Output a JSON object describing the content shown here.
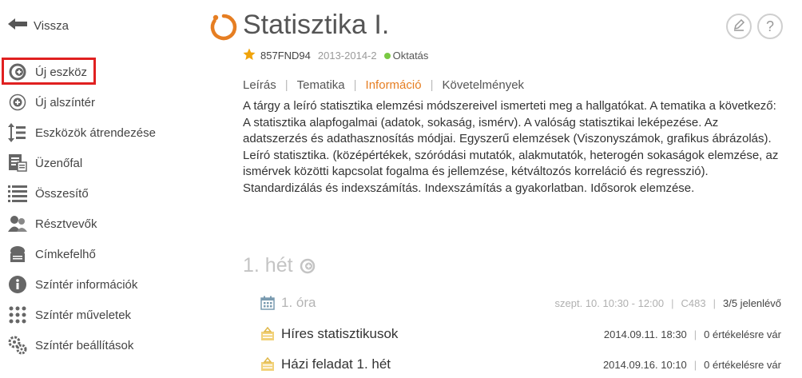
{
  "sidebar": {
    "back_label": "Vissza",
    "items": [
      {
        "label": "Új eszköz",
        "icon": "add-circle-icon"
      },
      {
        "label": "Új alszíntér",
        "icon": "add-circle-outline-icon"
      },
      {
        "label": "Eszközök átrendezése",
        "icon": "reorder-icon"
      },
      {
        "label": "Üzenőfal",
        "icon": "message-board-icon"
      },
      {
        "label": "Összesítő",
        "icon": "summary-list-icon"
      },
      {
        "label": "Résztvevők",
        "icon": "participants-icon"
      },
      {
        "label": "Címkefelhő",
        "icon": "tag-cloud-icon"
      },
      {
        "label": "Színtér információk",
        "icon": "info-icon"
      },
      {
        "label": "Színtér műveletek",
        "icon": "operations-icon"
      },
      {
        "label": "Színtér beállítások",
        "icon": "settings-icon"
      }
    ]
  },
  "header": {
    "title": "Statisztika I.",
    "code": "857FND94",
    "term": "2013-2014-2",
    "status": "Oktatás",
    "status_color": "#7ac943",
    "accent_color": "#e67e22"
  },
  "tabs": [
    {
      "label": "Leírás",
      "active": false
    },
    {
      "label": "Tematika",
      "active": false
    },
    {
      "label": "Információ",
      "active": true
    },
    {
      "label": "Követelmények",
      "active": false
    }
  ],
  "description": "A tárgy a leíró statisztika elemzési módszereivel ismerteti meg a hallgatókat.  A tematika a következő: A statisztika alapfogalmai (adatok, sokaság, ismérv). A valóság statisztikai leképezése. Az adatszerzés és adathasznosítás módjai. Egyszerű elemzések (Viszonyszámok, grafikus ábrázolás). Leíró statisztika. (középértékek, szóródási mutatók, alakmutatók, heterogén sokaságok elemzése, az ismérvek közötti kapcsolat fogalma és jellemzése, kétváltozós korreláció és regresszió). Standardizálás és indexszámítás. Indexszámítás a gyakorlatban. Idősorok elemzése.",
  "week": {
    "label": "1. hét",
    "items": [
      {
        "type": "session",
        "icon": "calendar-icon",
        "title": "1. óra",
        "time": "szept. 10. 10:30 - 12:00",
        "room": "C483",
        "attendance": "3/5 jelenlévő"
      },
      {
        "type": "assignment",
        "icon": "assignment-icon",
        "title": "Híres statisztikusok",
        "date": "2014.09.11. 18:30",
        "status": "0 értékelésre vár"
      },
      {
        "type": "assignment",
        "icon": "assignment-icon",
        "title": "Házi feladat 1. hét",
        "date": "2014.09.16. 10:10",
        "status": "0 értékelésre vár"
      }
    ]
  }
}
